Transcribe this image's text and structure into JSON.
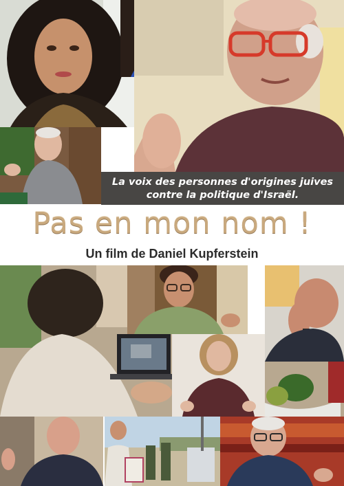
{
  "tagline": {
    "line1": "La voix des personnes d'origines juives",
    "line2": "contre la politique d'Israël."
  },
  "title": "Pas en mon nom !",
  "subtitle": "Un film de Daniel Kupferstein",
  "colors": {
    "title_gold": "#c9a97e",
    "tagline_band": "#141210",
    "subtitle_text": "#2b2b2b"
  }
}
